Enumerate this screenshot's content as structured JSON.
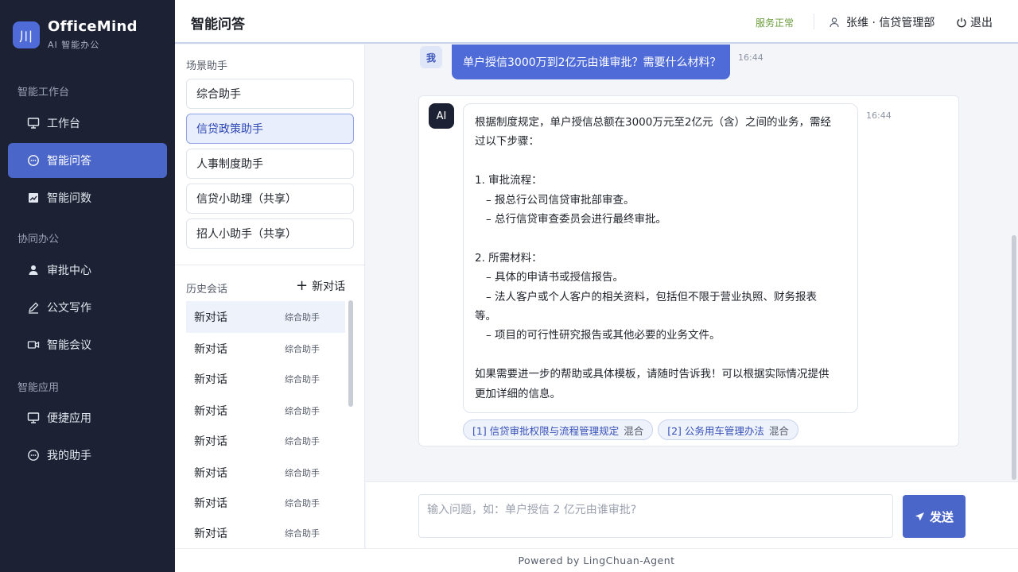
{
  "brand": {
    "logo_glyph": "川",
    "name": "OfficeMind",
    "subtitle": "AI 智能办公"
  },
  "sidebar": {
    "sections": [
      {
        "title": "智能工作台",
        "items": [
          {
            "label": "工作台",
            "icon": "monitor-icon"
          },
          {
            "label": "智能问答",
            "icon": "chat-bubble-icon",
            "active": true
          },
          {
            "label": "智能问数",
            "icon": "chart-icon"
          }
        ]
      },
      {
        "title": "协同办公",
        "items": [
          {
            "label": "审批中心",
            "icon": "person-icon"
          },
          {
            "label": "公文写作",
            "icon": "pen-icon"
          },
          {
            "label": "智能会议",
            "icon": "video-icon"
          }
        ]
      },
      {
        "title": "智能应用",
        "items": [
          {
            "label": "便捷应用",
            "icon": "monitor-icon"
          },
          {
            "label": "我的助手",
            "icon": "chat-bubble-icon"
          }
        ]
      }
    ]
  },
  "header": {
    "title": "智能问答",
    "status": "服务正常",
    "user": "张维 · 信贷管理部",
    "logout": "退出"
  },
  "assistants": {
    "label": "场景助手",
    "items": [
      "综合助手",
      "信贷政策助手",
      "人事制度助手",
      "信贷小助理（共享）",
      "招人小助手（共享）"
    ],
    "active_index": 1
  },
  "history": {
    "label": "历史会话",
    "new_chat": "新对话",
    "items": [
      {
        "title": "新对话",
        "tag": "综合助手"
      },
      {
        "title": "新对话",
        "tag": "综合助手"
      },
      {
        "title": "新对话",
        "tag": "综合助手"
      },
      {
        "title": "新对话",
        "tag": "综合助手"
      },
      {
        "title": "新对话",
        "tag": "综合助手"
      },
      {
        "title": "新对话",
        "tag": "综合助手"
      },
      {
        "title": "新对话",
        "tag": "综合助手"
      },
      {
        "title": "新对话",
        "tag": "综合助手"
      }
    ]
  },
  "chat": {
    "user_badge": "我",
    "user_message": "单户授信3000万到2亿元由谁审批？需要什么材料？",
    "user_time": "16:44",
    "ai_badge": "AI",
    "ai_time": "16:44",
    "ai_lines": [
      "根据制度规定，单户授信总额在3000万元至2亿元（含）之间的业务，需经",
      "过以下步骤：",
      "",
      "1. 审批流程：",
      "  – 报总行公司信贷审批部审查。",
      "  – 总行信贷审查委员会进行最终审批。",
      "",
      "2. 所需材料：",
      "  – 具体的申请书或授信报告。",
      "  – 法人客户或个人客户的相关资料，包括但不限于营业执照、财务报表",
      "等。",
      "  – 项目的可行性研究报告或其他必要的业务文件。",
      "",
      "如果需要进一步的帮助或具体模板，请随时告诉我！可以根据实际情况提供",
      "更加详细的信息。"
    ],
    "references": [
      {
        "label": "[1] 信贷审批权限与流程管理规定",
        "tag": "混合"
      },
      {
        "label": "[2] 公务用车管理办法",
        "tag": "混合"
      }
    ]
  },
  "input": {
    "placeholder": "输入问题，如：单户授信 2 亿元由谁审批?",
    "value": "",
    "send_label": "发送"
  },
  "footer": {
    "text": "Powered by LingChuan-Agent"
  },
  "colors": {
    "sidebar_bg": "#1c2233",
    "accent": "#4a66c8",
    "user_bubble": "#4f6bd8",
    "status_ok": "#6a9c3c"
  }
}
